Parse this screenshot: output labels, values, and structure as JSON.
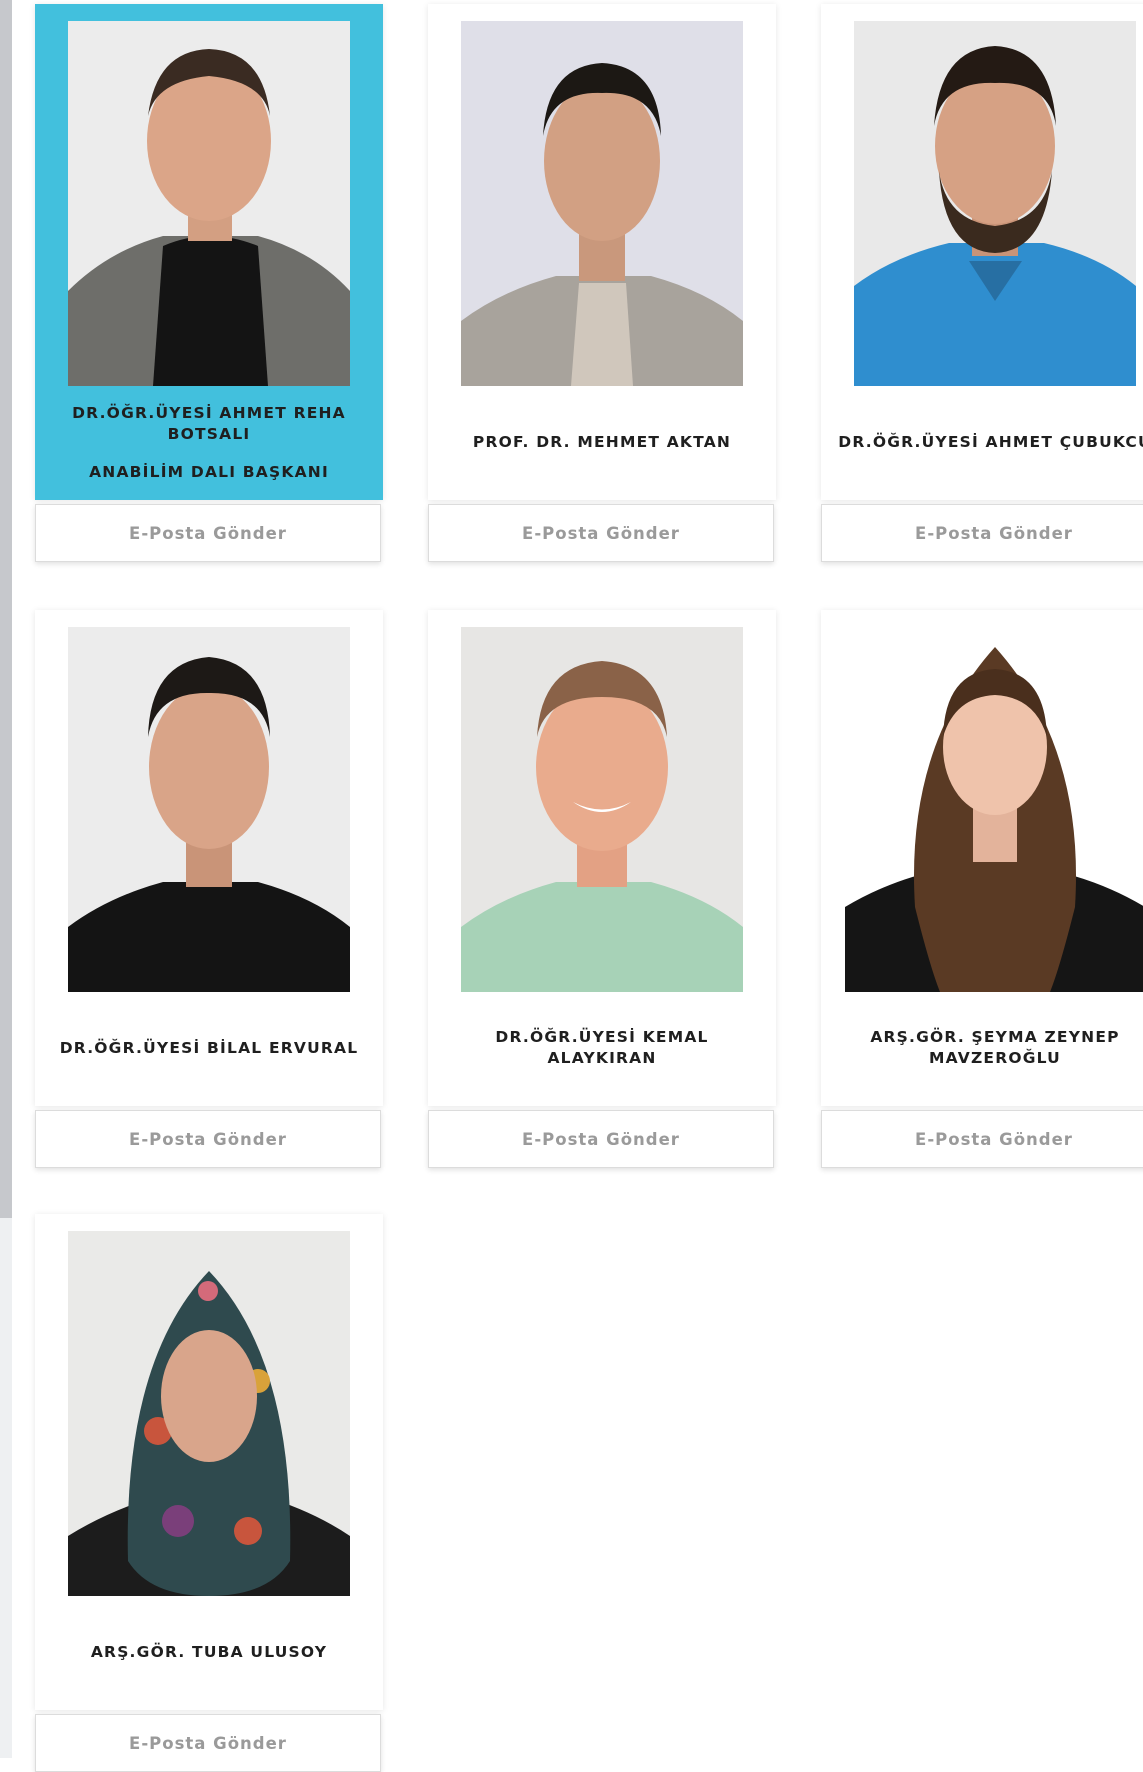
{
  "staff": [
    {
      "name": "DR.ÖĞR.ÜYESİ AHMET REHA BOTSALI",
      "role": "ANABİLİM DALI BAŞKANI",
      "email_label": "E-Posta Gönder",
      "highlighted": true
    },
    {
      "name": "PROF. DR. MEHMET AKTAN",
      "role": "",
      "email_label": "E-Posta Gönder",
      "highlighted": false
    },
    {
      "name": "DR.ÖĞR.ÜYESİ AHMET ÇUBUKCU",
      "role": "",
      "email_label": "E-Posta Gönder",
      "highlighted": false
    },
    {
      "name": "DR.ÖĞR.ÜYESİ BİLAL ERVURAL",
      "role": "",
      "email_label": "E-Posta Gönder",
      "highlighted": false
    },
    {
      "name": "DR.ÖĞR.ÜYESİ KEMAL ALAYKIRAN",
      "role": "",
      "email_label": "E-Posta Gönder",
      "highlighted": false
    },
    {
      "name": "ARŞ.GÖR. ŞEYMA ZEYNEP MAVZEROĞLU",
      "role": "",
      "email_label": "E-Posta Gönder",
      "highlighted": false
    },
    {
      "name": "ARŞ.GÖR. TUBA ULUSOY",
      "role": "",
      "email_label": "E-Posta Gönder",
      "highlighted": false
    }
  ],
  "colors": {
    "highlight": "#42c0dd",
    "button_text": "#9a9a9a",
    "name_text": "#1f1f1f"
  }
}
